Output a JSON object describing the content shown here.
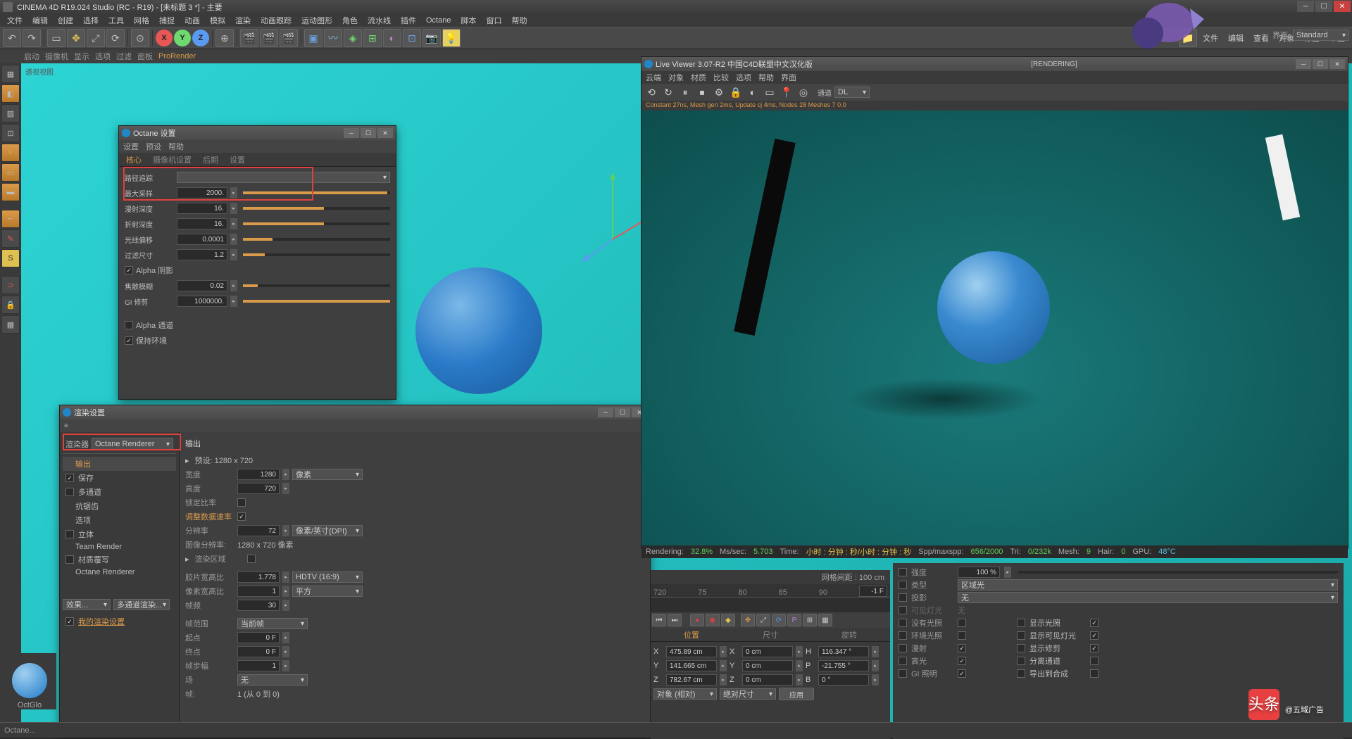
{
  "app": {
    "title": "CINEMA 4D R19.024 Studio (RC - R19) - [未标题 3 *] - 主要",
    "menus": [
      "文件",
      "编辑",
      "创建",
      "选择",
      "工具",
      "网格",
      "捕捉",
      "动画",
      "模拟",
      "渲染",
      "动画跟踪",
      "运动图形",
      "角色",
      "流水线",
      "插件",
      "Octane",
      "脚本",
      "窗口",
      "帮助"
    ],
    "layout_label": "界面:",
    "layout_value": "Standard"
  },
  "sub_toolbar": {
    "items": [
      "启动",
      "摄像机",
      "显示",
      "选项",
      "过滤",
      "面板",
      "ProRender"
    ],
    "active": 6
  },
  "viewport": {
    "label": "透视视图"
  },
  "octane_settings": {
    "title": "Octane 设置",
    "menus": [
      "设置",
      "预设",
      "帮助"
    ],
    "tabs": [
      "核心",
      "摄像机设置",
      "后期",
      "设置"
    ],
    "active_tab": 0,
    "params": {
      "path_tracing_label": "路径追踪",
      "max_samples_label": "最大采样",
      "max_samples": "2000.",
      "diffuse_depth_label": "漫射深度",
      "diffuse_depth": "16.",
      "refract_depth_label": "折射深度",
      "refract_depth": "16.",
      "ray_epsilon_label": "光线偏移",
      "ray_epsilon": "0.0001",
      "filter_size_label": "过滤尺寸",
      "filter_size": "1.2",
      "alpha_shadow_label": "Alpha 阴影",
      "caustic_blur_label": "焦散模糊",
      "caustic_blur": "0.02",
      "gi_clamp_label": "GI 修剪",
      "gi_clamp": "1000000.",
      "alpha_channel_label": "Alpha 通道",
      "keep_env_label": "保持环境"
    }
  },
  "render_settings": {
    "title": "渲染设置",
    "renderer_label": "渲染器",
    "renderer_value": "Octane Renderer",
    "sidebar": [
      "输出",
      "保存",
      "多通道",
      "抗锯齿",
      "选项",
      "立体",
      "Team Render",
      "材质覆写",
      "Octane Renderer"
    ],
    "buttons": {
      "effects": "效果...",
      "multipass": "多通道渲染...",
      "my_settings": "我的渲染设置"
    },
    "output": {
      "heading": "输出",
      "preset_label": "预设: 1280 x 720",
      "width_label": "宽度",
      "width": "1280",
      "width_unit": "像素",
      "height_label": "高度",
      "height": "720",
      "lock_ratio_label": "锁定比率",
      "adjust_rate_label": "调整数据速率",
      "resolution_label": "分辨率",
      "resolution": "72",
      "res_unit": "像素/英寸(DPI)",
      "image_res_label": "图像分辨率:",
      "image_res": "1280 x 720 像素",
      "region_label": "渲染区域",
      "film_aspect_label": "胶片宽高比",
      "film_aspect": "1.778",
      "film_preset": "HDTV (16:9)",
      "pixel_aspect_label": "像素宽高比",
      "pixel_aspect": "1",
      "pixel_preset": "平方",
      "fps_label": "帧频",
      "fps": "30",
      "frame_range_label": "帧范围",
      "frame_range": "当前帧",
      "start_label": "起点",
      "start": "0 F",
      "end_label": "终点",
      "end": "0 F",
      "step_label": "帧步幅",
      "step": "1",
      "field_label": "场",
      "field": "无",
      "frames_label": "帧:",
      "frames": "1 (从 0 到 0)"
    }
  },
  "live_viewer": {
    "title": "Live Viewer 3.07-R2 中国C4D联盟中文汉化版",
    "menus": [
      "云端",
      "对象",
      "材质",
      "比较",
      "选项",
      "帮助",
      "界面"
    ],
    "status_center": "[RENDERING]",
    "dropdown_label": "通道",
    "dropdown_value": "DL",
    "render_status_text": "Constant 27ns, Mesh gen 2ms, Update cj 4ms, Nodes 28 Meshes 7 0.0",
    "status": {
      "rendering": "Rendering:",
      "rendering_pct": "32.8%",
      "mssec": "Ms/sec:",
      "mssec_val": "5.703",
      "time": "Time:",
      "time_val": "小时 : 分钟 : 秒/小时 : 分钟 : 秒",
      "spp": "Spp/maxspp:",
      "spp_val": "656/2000",
      "tri": "Tri:",
      "tri_val": "0/232k",
      "mesh": "Mesh:",
      "mesh_val": "9",
      "hair": "Hair:",
      "hair_val": "0",
      "gpu": "GPU:",
      "gpu_val": "48°C"
    }
  },
  "timeline": {
    "grid_spacing_label": "网格间距 : 100 cm",
    "ruler": [
      "720",
      "75",
      "80",
      "85",
      "90"
    ],
    "current": "-1 F",
    "tabs": [
      "位置",
      "尺寸",
      "旋转"
    ],
    "coords": {
      "x": "475.89 cm",
      "sx": "0 cm",
      "h": "116.347 °",
      "y": "141.665 cm",
      "sy": "0 cm",
      "p": "-21.755 °",
      "z": "782.67 cm",
      "sz": "0 cm",
      "b": "0 °"
    },
    "mode1": "对象 (相对)",
    "mode2": "绝对尺寸",
    "apply": "应用"
  },
  "attributes": {
    "rows": [
      {
        "label": "强度",
        "value": "100 %"
      },
      {
        "label": "类型",
        "value": "区域光"
      },
      {
        "label": "投影",
        "value": "无"
      }
    ],
    "checks": {
      "visible_light": "可见灯光",
      "visible_light_val": "无",
      "no_lighting": "没有光照",
      "show_lighting": "显示光照",
      "ambient": "环境光照",
      "show_visible": "显示可见灯光",
      "diffuse": "漫射",
      "show_trim_frame": "显示修剪",
      "highlight": "高光",
      "separate_channels": "分离通道",
      "gi": "GI 照明",
      "export_composite": "导出到合成"
    }
  },
  "statusbar": {
    "material": "OctGlo",
    "hint": "Octane..."
  },
  "watermark": {
    "brand": "头条",
    "text": "@五域广告"
  }
}
